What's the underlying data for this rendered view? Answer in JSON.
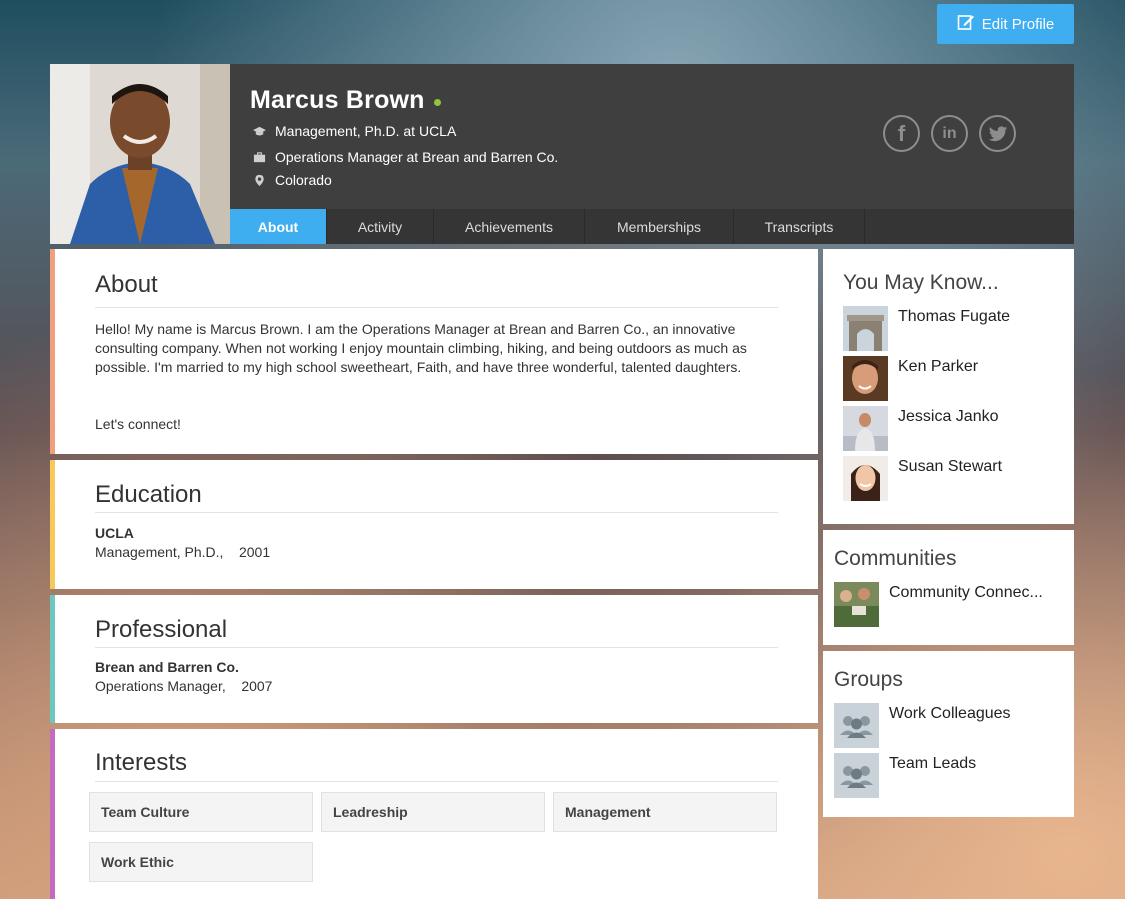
{
  "edit_profile_label": "Edit Profile",
  "profile": {
    "name": "Marcus Brown",
    "education_line": "Management, Ph.D. at UCLA",
    "job_line": "Operations Manager at Brean and Barren Co.",
    "location": "Colorado"
  },
  "social": {
    "facebook": "f",
    "linkedin": "in"
  },
  "tabs": [
    {
      "label": "About"
    },
    {
      "label": "Activity"
    },
    {
      "label": "Achievements"
    },
    {
      "label": "Memberships"
    },
    {
      "label": "Transcripts"
    }
  ],
  "about": {
    "title": "About",
    "paragraph1": "Hello! My name is Marcus Brown. I am the Operations Manager at Brean and Barren Co., an innovative consulting company. When not working I enjoy mountain climbing, hiking, and being outdoors as much as possible. I'm married to my high school sweetheart, Faith, and have three wonderful, talented daughters.",
    "paragraph2": "Let's connect!"
  },
  "education": {
    "title": "Education",
    "school": "UCLA",
    "degree": "Management, Ph.D.,",
    "year": "2001"
  },
  "professional": {
    "title": "Professional",
    "company": "Brean and Barren Co.",
    "role": "Operations Manager,",
    "year": "2007"
  },
  "interests": {
    "title": "Interests",
    "items": [
      "Team Culture",
      "Leadreship",
      "Management",
      "Work Ethic"
    ]
  },
  "you_may_know": {
    "title": "You May Know...",
    "people": [
      {
        "name": "Thomas Fugate"
      },
      {
        "name": "Ken Parker"
      },
      {
        "name": "Jessica Janko"
      },
      {
        "name": "Susan Stewart"
      }
    ]
  },
  "communities": {
    "title": "Communities",
    "items": [
      {
        "name": "Community Connec..."
      }
    ]
  },
  "groups": {
    "title": "Groups",
    "items": [
      {
        "name": "Work Colleagues"
      },
      {
        "name": "Team Leads"
      }
    ]
  },
  "colors": {
    "accent": "#3eaef0",
    "online": "#8fc63d",
    "about_bar": "#f0a07e",
    "education_bar": "#f7c95a",
    "professional_bar": "#6cc7c1",
    "interests_bar": "#c36ac2"
  }
}
